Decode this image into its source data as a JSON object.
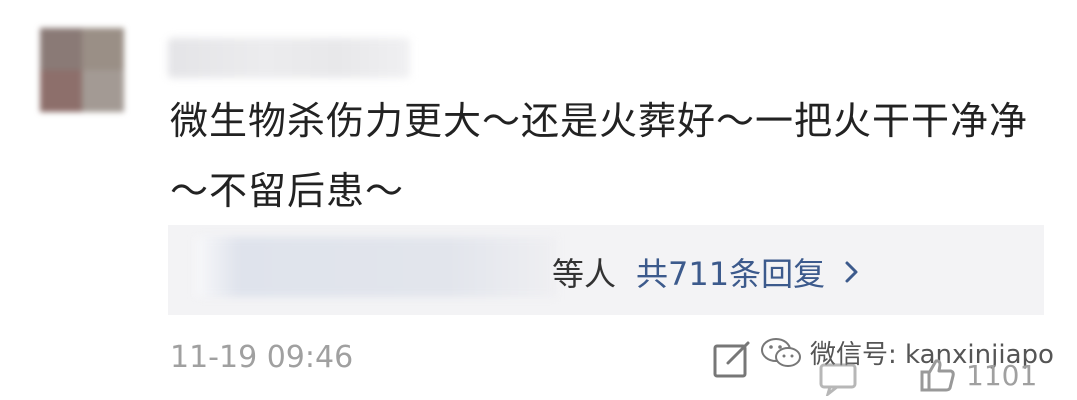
{
  "comment": {
    "body": "微生物杀伤力更大～还是火葬好～一把火干干净净～不留后患～",
    "timestamp": "11-19 09:46",
    "like_count": "1101"
  },
  "replies": {
    "partial_label": "等人",
    "count_label": "共711条回复"
  },
  "watermark": {
    "text": "微信号: kanxinjiapo"
  },
  "icons": {
    "reply_chevron": "chevron-right-icon",
    "edit": "edit-icon",
    "comment": "comment-icon",
    "like": "thumbs-up-icon",
    "wechat": "wechat-icon"
  },
  "colors": {
    "link": "#3c5a8c",
    "muted": "#a0a0a0",
    "reply_bg": "#f3f3f5"
  }
}
